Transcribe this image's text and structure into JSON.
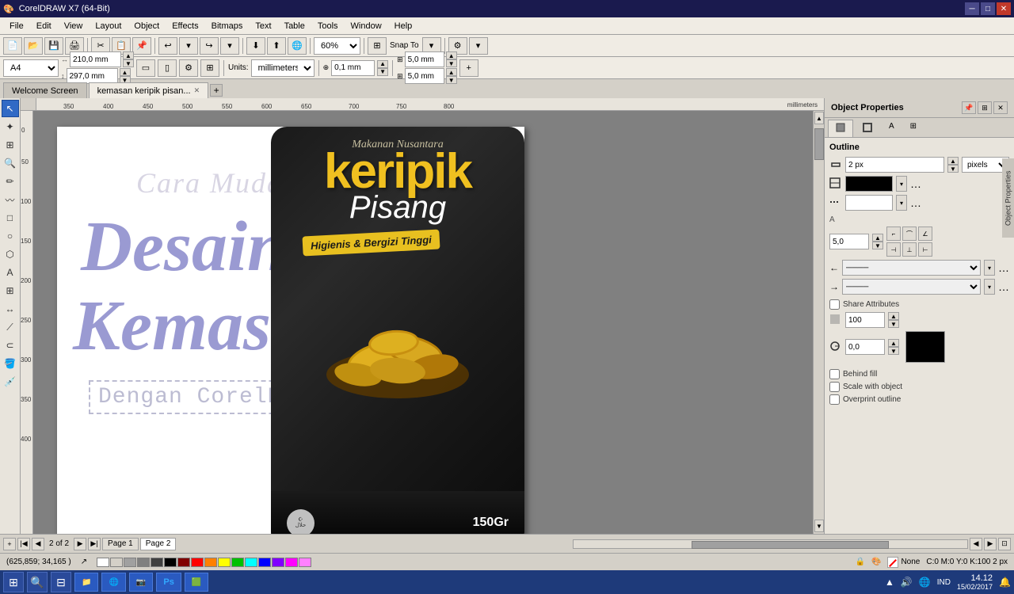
{
  "titlebar": {
    "title": "CorelDRAW X7 (64-Bit)",
    "icon": "🎨"
  },
  "menubar": {
    "items": [
      "File",
      "Edit",
      "View",
      "Layout",
      "Object",
      "Effects",
      "Bitmaps",
      "Text",
      "Table",
      "Tools",
      "Window",
      "Help"
    ]
  },
  "toolbar1": {
    "zoom_label": "60%",
    "snap_label": "Snap To"
  },
  "toolbar2": {
    "paper_size": "A4",
    "width_label": "210,0 mm",
    "height_label": "297,0 mm",
    "units_label": "millimeters",
    "nudge_label": "0,1 mm",
    "grid_x": "5,0 mm",
    "grid_y": "5,0 mm"
  },
  "tabs": {
    "items": [
      "Welcome Screen",
      "kemasan keripik pisan..."
    ],
    "active": 1
  },
  "canvas": {
    "text_cara_mudah": "Cara Mudah",
    "text_desain": "Desain",
    "text_kemasan": "Kemasan",
    "text_dengan": "Dengan CorelDraw X7",
    "bag_top": "Makanan Nusantara",
    "bag_title1": "keripik",
    "bag_title2": "Pisang",
    "bag_subtitle": "Higienis & Bergizi Tinggi",
    "bag_weight": "150Gr"
  },
  "right_panel": {
    "title": "Object Properties",
    "section": "Outline",
    "size_value": "2 px",
    "size_unit": "pixels",
    "num_value": "5,0",
    "opacity_value": "100",
    "angle_value": "0,0",
    "share_attrs_label": "Share Attributes",
    "behind_fill_label": "Behind fill",
    "scale_object_label": "Scale with object",
    "overprint_label": "Overprint outline"
  },
  "bottom_nav": {
    "page_info": "2 of 2",
    "page1_label": "Page 1",
    "page2_label": "Page 2"
  },
  "status_bar": {
    "coords": "(625,859; 34,165 )",
    "fill_label": "C:0 M:0 Y:0 K:100  2 px",
    "fill_type": "None"
  },
  "taskbar": {
    "time": "14.12",
    "date": "15/02/2017",
    "lang": "IND",
    "apps": [
      "",
      "🔍",
      "📁",
      "🌐",
      "📷",
      "🎭",
      "🟩"
    ]
  },
  "colors": {
    "accent_blue": "#7070c0",
    "bag_yellow": "#f0c020",
    "bag_dark": "#1a1a1a",
    "outline_black": "#000000",
    "swatch_colors": [
      "#ffffff",
      "#d4d0c8",
      "#a0a0a0",
      "#808080",
      "#404040",
      "#000000",
      "#800000",
      "#ff0000",
      "#ff8000",
      "#ffff00",
      "#00ff00",
      "#00ffff",
      "#0000ff",
      "#8000ff"
    ]
  }
}
